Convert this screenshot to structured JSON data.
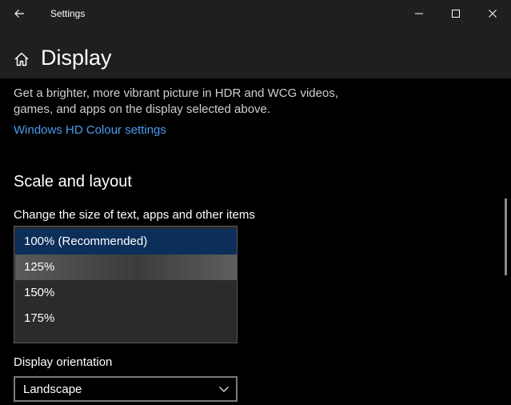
{
  "window": {
    "title": "Settings"
  },
  "header": {
    "page_title": "Display"
  },
  "hdr": {
    "description": "Get a brighter, more vibrant picture in HDR and WCG videos, games, and apps on the display selected above.",
    "link": "Windows HD Colour settings"
  },
  "scale_layout": {
    "heading": "Scale and layout",
    "size_label": "Change the size of text, apps and other items",
    "options": [
      {
        "label": "100% (Recommended)",
        "selected": true
      },
      {
        "label": "125%",
        "hovered": true
      },
      {
        "label": "150%"
      },
      {
        "label": "175%"
      }
    ],
    "orientation_label": "Display orientation",
    "orientation_value": "Landscape"
  },
  "icons": {
    "back": "back-arrow-icon",
    "home": "home-icon",
    "minimize": "minimize-icon",
    "maximize": "maximize-icon",
    "close": "close-icon",
    "dropdown": "chevron-down-icon"
  },
  "colors": {
    "accent_link": "#4c9bf0",
    "selected_item": "#0c2f59",
    "background": "#000000",
    "titlebar": "#1f1f1f"
  }
}
